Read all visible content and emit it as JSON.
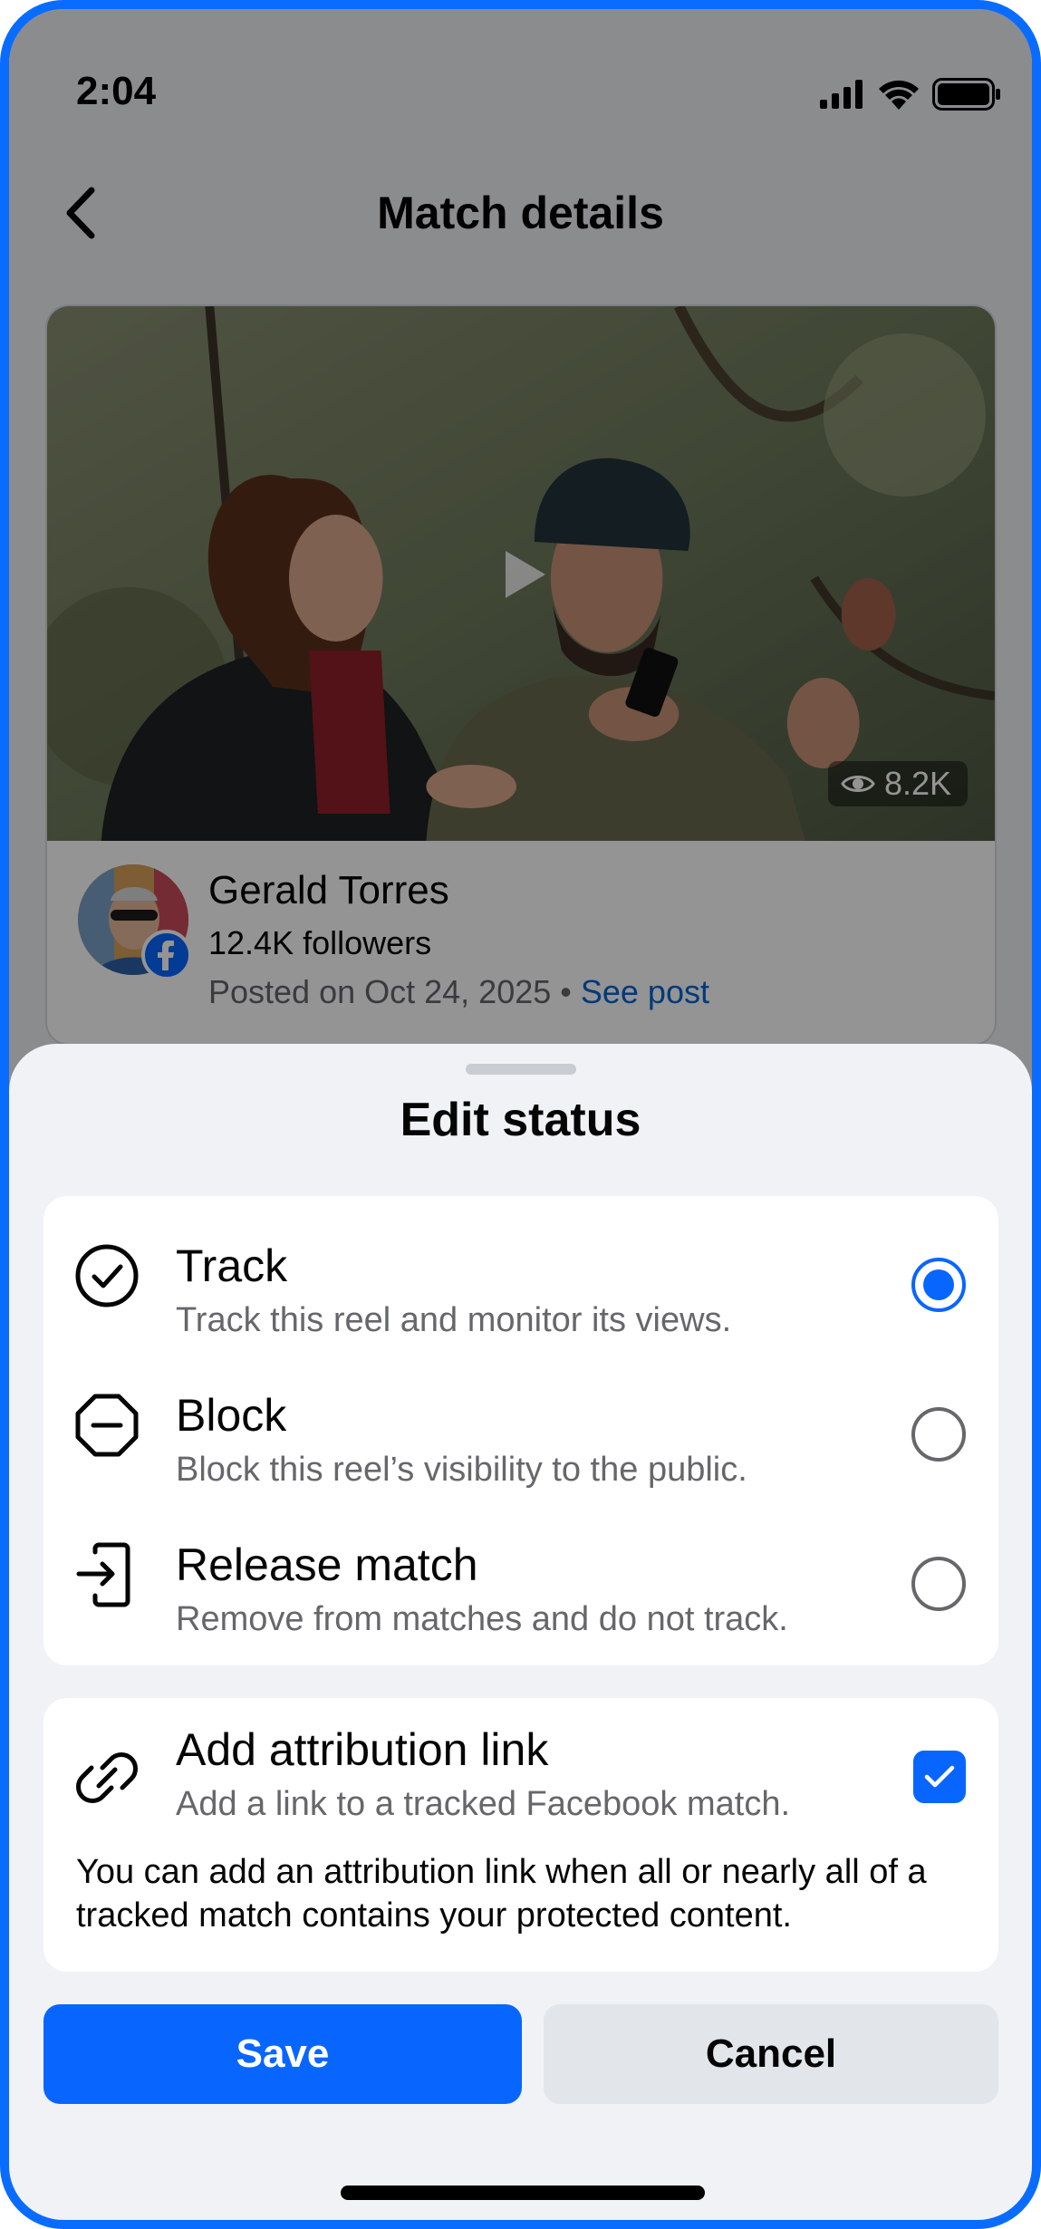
{
  "status_bar": {
    "time": "2:04"
  },
  "nav": {
    "title": "Match details"
  },
  "post": {
    "views": "8.2K",
    "author_name": "Gerald Torres",
    "followers": "12.4K followers",
    "posted": "Posted on Oct 24, 2025",
    "separator": "•",
    "see_post": "See post"
  },
  "sheet": {
    "title": "Edit status",
    "options": [
      {
        "title": "Track",
        "subtitle": "Track this reel and monitor its views.",
        "selected": true
      },
      {
        "title": "Block",
        "subtitle": "Block this reel’s visibility to the public.",
        "selected": false
      },
      {
        "title": "Release match",
        "subtitle": "Remove from matches and do not track.",
        "selected": false
      }
    ],
    "attribution": {
      "title": "Add attribution link",
      "subtitle": "Add a link to a tracked Facebook match.",
      "checked": true,
      "note": "You can add an attribution link when all or nearly all of a tracked match contains your protected content."
    },
    "save_label": "Save",
    "cancel_label": "Cancel"
  },
  "colors": {
    "accent": "#0866ff",
    "frame": "#0a6cff",
    "link": "#0064d1"
  }
}
